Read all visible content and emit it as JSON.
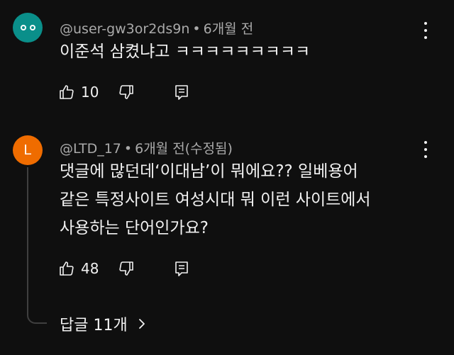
{
  "comments": [
    {
      "author": "@user-gw3or2ds9n",
      "separator": "•",
      "time": "6개월 전",
      "lines": [
        "이준석 삼켰냐고 ㅋㅋㅋㅋㅋㅋㅋㅋㅋ"
      ],
      "likes": "10",
      "avatar_icon": "face-eyes-icon",
      "avatar_color": "#0a8f8a"
    },
    {
      "author": "@LTD_17",
      "separator": "•",
      "time": "6개월 전(수정됨)",
      "lines": [
        "댓글에 많던데‘이대남’이 뭐에요?? 일베용어",
        "같은 특정사이트 여성시대 뭐 이런 사이트에서",
        "사용하는 단어인가요?"
      ],
      "likes": "48",
      "avatar_letter": "L",
      "avatar_color": "#ef6c00"
    }
  ],
  "replies_label": "답글 11개",
  "icons": {
    "like": "thumbs-up-icon",
    "dislike": "thumbs-down-icon",
    "reply": "reply-icon",
    "more": "more-vertical-icon",
    "expand": "chevron-right-icon"
  }
}
